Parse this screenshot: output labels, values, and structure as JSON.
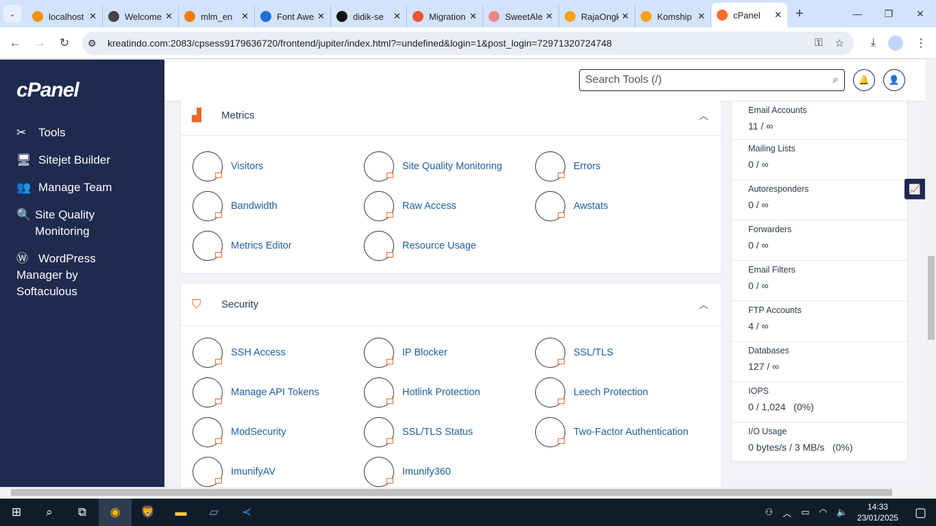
{
  "browser": {
    "tabs": [
      {
        "title": "localhost",
        "color": "#f29111"
      },
      {
        "title": "Welcome",
        "color": "#444"
      },
      {
        "title": "mlm_en",
        "color": "#f57c00"
      },
      {
        "title": "Font Awesome",
        "color": "#1c6ed8"
      },
      {
        "title": "didik-se",
        "color": "#111"
      },
      {
        "title": "Migration",
        "color": "#e53"
      },
      {
        "title": "SweetAlert",
        "color": "#e88"
      },
      {
        "title": "RajaOngkir",
        "color": "#f6a21a"
      },
      {
        "title": "Komship",
        "color": "#f6a21a"
      },
      {
        "title": "cPanel",
        "color": "#ff6c2c",
        "active": true
      }
    ],
    "url": "kreatindo.com:2083/cpsess9179636720/frontend/jupiter/index.html?=undefined&login=1&post_login=72971320724748"
  },
  "sidebar": {
    "logo": "cPanel",
    "items": [
      {
        "label": "Tools",
        "icon": "tools-icon"
      },
      {
        "label": "Sitejet Builder",
        "icon": "monitor-icon"
      },
      {
        "label": "Manage Team",
        "icon": "team-icon"
      },
      {
        "label": "Site Quality Monitoring",
        "icon": "search-check-icon"
      },
      {
        "label": "WordPress Manager by Softaculous",
        "icon": "wordpress-icon"
      }
    ]
  },
  "header": {
    "search_placeholder": "Search Tools (/)"
  },
  "metrics": {
    "title": "Metrics",
    "tools": [
      "Visitors",
      "Site Quality Monitoring",
      "Errors",
      "Bandwidth",
      "Raw Access",
      "Awstats",
      "Metrics Editor",
      "Resource Usage"
    ]
  },
  "security": {
    "title": "Security",
    "tools": [
      "SSH Access",
      "IP Blocker",
      "SSL/TLS",
      "Manage API Tokens",
      "Hotlink Protection",
      "Leech Protection",
      "ModSecurity",
      "SSL/TLS Status",
      "Two-Factor Authentication",
      "ImunifyAV",
      "Imunify360"
    ]
  },
  "stats": [
    {
      "label": "Email Accounts",
      "value": "11 / ∞"
    },
    {
      "label": "Mailing Lists",
      "value": "0 / ∞"
    },
    {
      "label": "Autoresponders",
      "value": "0 / ∞"
    },
    {
      "label": "Forwarders",
      "value": "0 / ∞"
    },
    {
      "label": "Email Filters",
      "value": "0 / ∞"
    },
    {
      "label": "FTP Accounts",
      "value": "4 / ∞"
    },
    {
      "label": "Databases",
      "value": "127 / ∞"
    },
    {
      "label": "IOPS",
      "value": "0 / 1,024   (0%)"
    },
    {
      "label": "I/O Usage",
      "value": "0 bytes/s / 3 MB/s   (0%)"
    }
  ],
  "taskbar": {
    "time": "14:33",
    "date": "23/01/2025"
  }
}
